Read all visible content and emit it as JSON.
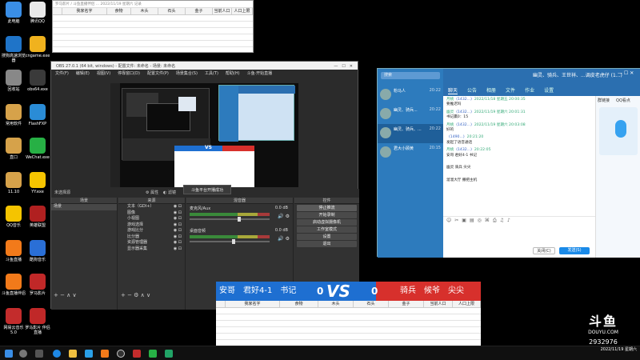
{
  "desktop_icons": [
    {
      "label": "此电脑",
      "color": "#3a8ee6"
    },
    {
      "label": "腾讯QQ",
      "color": "#e8e8e8"
    },
    {
      "label": "搜狗高速浏览器",
      "color": "#1f74c8"
    },
    {
      "label": "cngame.exe",
      "color": "#f0b21e"
    },
    {
      "label": "回收站",
      "color": "#888888"
    },
    {
      "label": "obs64.exe",
      "color": "#3a3a3a"
    },
    {
      "label": "常用软件",
      "color": "#d6a24a"
    },
    {
      "label": "FlashFXP",
      "color": "#2a8cd6"
    },
    {
      "label": "直口",
      "color": "#d6a24a"
    },
    {
      "label": "WeChat.exe",
      "color": "#27b045"
    },
    {
      "label": "11.10",
      "color": "#d6a24a"
    },
    {
      "label": "YY.exe",
      "color": "#f5c400"
    },
    {
      "label": "QQ音乐",
      "color": "#f5c400"
    },
    {
      "label": "英雄联盟",
      "color": "#b02020"
    },
    {
      "label": "斗鱼直播",
      "color": "#f27a1a"
    },
    {
      "label": "酷狗音乐",
      "color": "#2a6fd6"
    },
    {
      "label": "斗鱼直播伴侣",
      "color": "#f27a1a"
    },
    {
      "label": "罗马影片",
      "color": "#c02828"
    },
    {
      "label": "网易云音乐 5.0",
      "color": "#c32c2c"
    },
    {
      "label": "罗马影片 伴侣 直播",
      "color": "#c02828"
    }
  ],
  "excel_top": {
    "title": "罗马影片 / 斗鱼直播伴侣 ... 2022/11/19 星期六 记录",
    "columns": [
      "我家名字",
      "食物",
      "木头",
      "石头",
      "金子",
      "当前人口",
      "人口上限"
    ]
  },
  "obs": {
    "title": "OBS 27.0.1 (64 bit, windows) - 配置文件: 未命名 - 场景: 未命名",
    "menu": [
      "文件(F)",
      "编辑(E)",
      "视图(V)",
      "停靠窗口(D)",
      "配置文件(P)",
      "场景集合(S)",
      "工具(T)",
      "帮助(H)",
      "斗鱼·开始直播"
    ],
    "status_left": "未选择源",
    "btn_properties": "属性",
    "btn_filters": "滤镜",
    "toast": "斗鱼平台开播成功",
    "overlay_vs": "VS",
    "dock_scenes": "场景",
    "dock_sources": "来源",
    "dock_mixer": "混音器",
    "dock_controls": "控件",
    "scene_item": "场景",
    "sources": [
      "文本（GDI+）",
      "图像",
      "小视图",
      "游戏选择",
      "游戏比分",
      "比分器",
      "资源管理器",
      "显示器采集"
    ],
    "mixer_tracks": [
      {
        "name": "麦克风/Aux",
        "db": "0.0 dB",
        "level": 0.62
      },
      {
        "name": "桌面音频",
        "db": "0.0 dB",
        "level": 0.55
      }
    ],
    "controls": [
      "停止推流",
      "开始录制",
      "启动虚拟摄像机",
      "工作室模式",
      "设置",
      "退出"
    ]
  },
  "qq": {
    "title": "幽灵、骑兵、王世祥、...调皮老虎仔 (1...)",
    "search_placeholder": "搜索",
    "tabs": [
      "聊天",
      "公告",
      "相册",
      "文件",
      "作业",
      "设置"
    ],
    "contacts": [
      {
        "name": "粉马人",
        "time": "20:22"
      },
      {
        "name": "幽灵、骑兵...",
        "time": "20:22"
      },
      {
        "name": "幽灵、骑兵、...",
        "time": "20:22"
      },
      {
        "name": "君大小顾黄",
        "time": "20:15"
      }
    ],
    "messages": [
      {
        "meta": "月桃",
        "id": "(1432...)",
        "time": "2022/11/18 星期五 20:00:35",
        "text": "要推迟吗"
      },
      {
        "meta": "幽灵",
        "id": "(1432...)",
        "time": "2022/11/19 星期六 20:01:31",
        "text": "书记赢0：15"
      },
      {
        "meta": "月桃",
        "id": "(1432...)",
        "time": "2022/11/19 星期六 20:03:08",
        "text": "好的"
      },
      {
        "meta": "",
        "id": "(1490...)",
        "time": "20:21:20",
        "text": "发起了语音通话"
      },
      {
        "meta": "月桃",
        "id": "(1432...)",
        "time": "20:22:05",
        "text": "安哥 君好4-1 书记"
      },
      {
        "meta": "",
        "id": "",
        "time": "",
        "text": "幽灵 骑兵 尖尖"
      },
      {
        "meta": "",
        "id": "",
        "time": "",
        "text": "溜溜大厅 撒把主机"
      }
    ],
    "right_panel": {
      "tab1": "群链接",
      "tab2": "QQ看点"
    },
    "btn_close": "关闭(C)",
    "btn_send": "发送(S)"
  },
  "vs_banner": {
    "left_team": "安哥　君好4-1　书记",
    "left_score": "0",
    "vs": "VS",
    "right_score": "0",
    "right_team": "骑兵　候爷　尖尖"
  },
  "excel_bottom": {
    "columns": [
      "我家名字",
      "食物",
      "木头",
      "石头",
      "金子",
      "当前人口",
      "人口上限"
    ]
  },
  "watermark": {
    "logo": "斗鱼",
    "sub": "DOUYU.COM",
    "room": "2932976"
  },
  "taskbar": {
    "date": "2022/11/19 星期六",
    "time": "",
    "colors": {
      "douyu": "#f27a1a"
    }
  }
}
